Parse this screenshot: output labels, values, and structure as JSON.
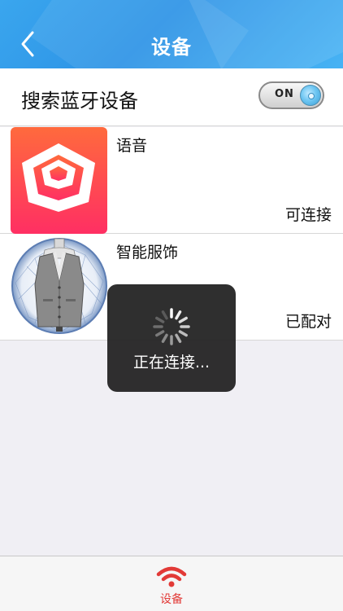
{
  "header": {
    "title": "设备",
    "back_icon": "chevron-left-icon"
  },
  "bluetooth": {
    "label": "搜索蓝牙设备",
    "toggle_text": "ON",
    "enabled": true
  },
  "devices": [
    {
      "name": "语音",
      "status": "可连接",
      "icon": "layered-hexagon-logo"
    },
    {
      "name": "智能服饰",
      "status": "已配对",
      "icon": "smart-vest-image"
    }
  ],
  "toast": {
    "text": "正在连接..."
  },
  "tabbar": {
    "items": [
      {
        "label": "设备",
        "icon": "wifi-signal-icon",
        "active": true
      }
    ]
  },
  "colors": {
    "header": "#2d93e6",
    "accent": "#e23a37",
    "logo_gradient_top": "#ff6a3d",
    "logo_gradient_bottom": "#ff2f63"
  }
}
